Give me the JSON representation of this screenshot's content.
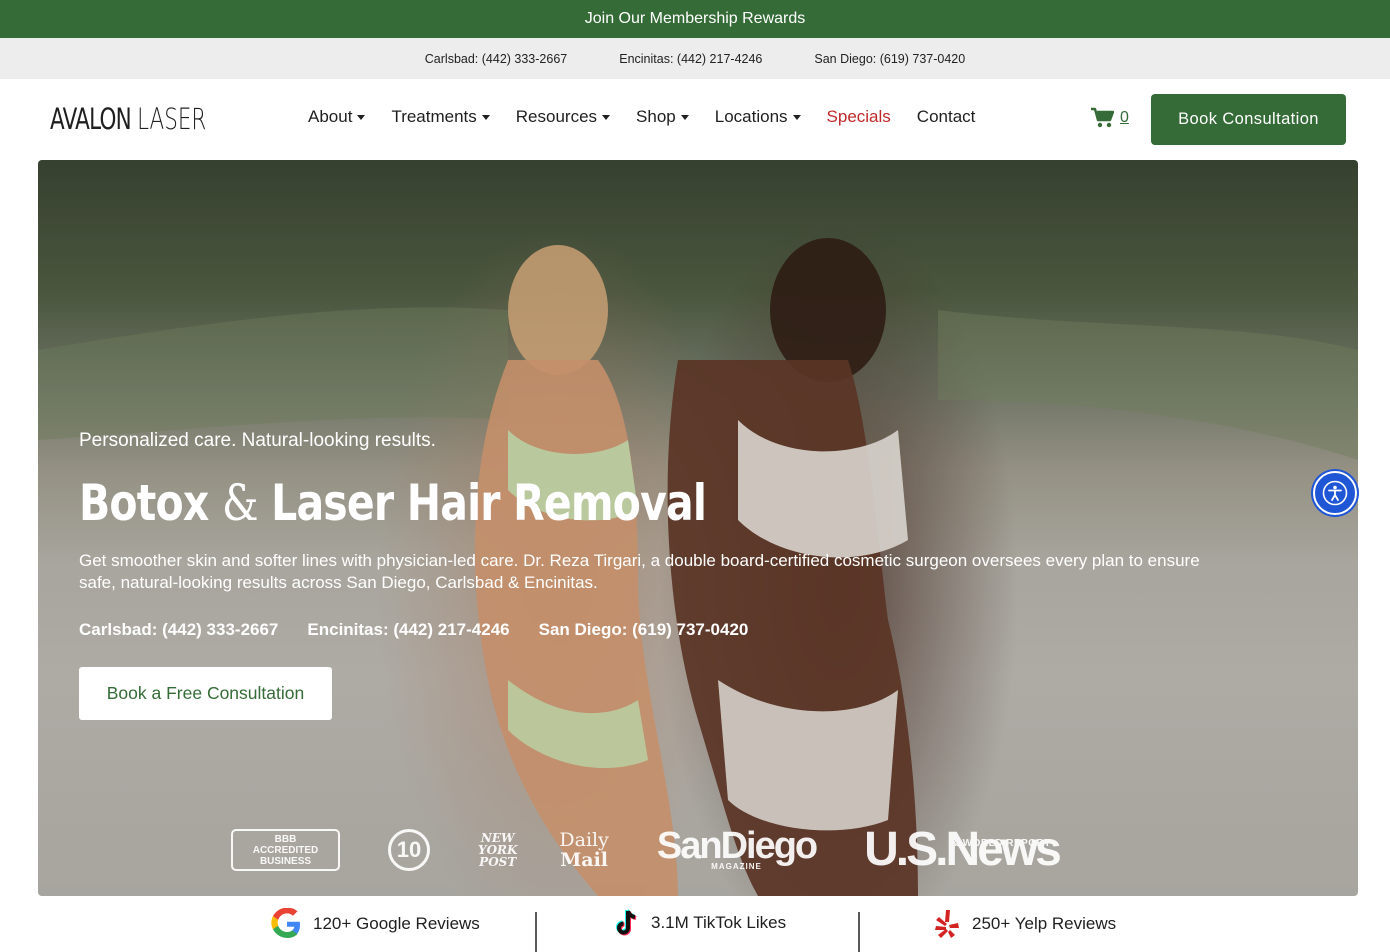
{
  "promo": {
    "text": "Join Our Membership Rewards"
  },
  "phones_top": [
    "Carlsbad: (442) 333-2667",
    "Encinitas: (442) 217-4246",
    "San Diego: (619) 737-0420"
  ],
  "logo": {
    "bold": "AVALON",
    "thin": "LASER"
  },
  "nav": {
    "items": [
      {
        "label": "About",
        "dropdown": true
      },
      {
        "label": "Treatments",
        "dropdown": true
      },
      {
        "label": "Resources",
        "dropdown": true
      },
      {
        "label": "Shop",
        "dropdown": true
      },
      {
        "label": "Locations",
        "dropdown": true
      },
      {
        "label": "Specials",
        "dropdown": false
      },
      {
        "label": "Contact",
        "dropdown": false
      }
    ]
  },
  "cart": {
    "count": "0",
    "icon": "cart-icon"
  },
  "header_cta": {
    "label": "Book Consultation"
  },
  "hero": {
    "tagline": "Personalized care. Natural-looking results.",
    "title_part1": "Botox",
    "title_amp": "&",
    "title_part2": "Laser Hair Removal",
    "description": "Get smoother skin and softer lines with physician-led care. Dr. Reza Tirgari, a double board-certified cosmetic surgeon oversees every plan to ensure safe, natural-looking results across San Diego, Carlsbad & Encinitas.",
    "phones": [
      "Carlsbad: (442) 333-2667",
      "Encinitas: (442) 217-4246",
      "San Diego: (619) 737-0420"
    ],
    "cta_label": "Book a Free Consultation"
  },
  "press": {
    "bbb_line1": "ACCREDITED",
    "bbb_line2": "BUSINESS",
    "bbb_mark": "BBB",
    "abc": "10",
    "nyp_line1": "NEW",
    "nyp_line2": "YORK",
    "nyp_line3": "POST",
    "daily_line1": "Daily",
    "daily_line2": "Mail",
    "sandiego": "SanDiego",
    "sandiego_sub": "MAGAZINE",
    "usnews": "U.S.News",
    "usnews_sub": "& WORLD REPORT"
  },
  "reviews": [
    {
      "label": "120+ Google Reviews",
      "icon": "google-icon"
    },
    {
      "label": "3.1M TikTok Likes",
      "icon": "tiktok-icon"
    },
    {
      "label": "250+ Yelp Reviews",
      "icon": "yelp-icon"
    }
  ],
  "colors": {
    "brand_green": "#356b37",
    "specials_red": "#c0292b",
    "accessibility_blue": "#1e56d6"
  }
}
